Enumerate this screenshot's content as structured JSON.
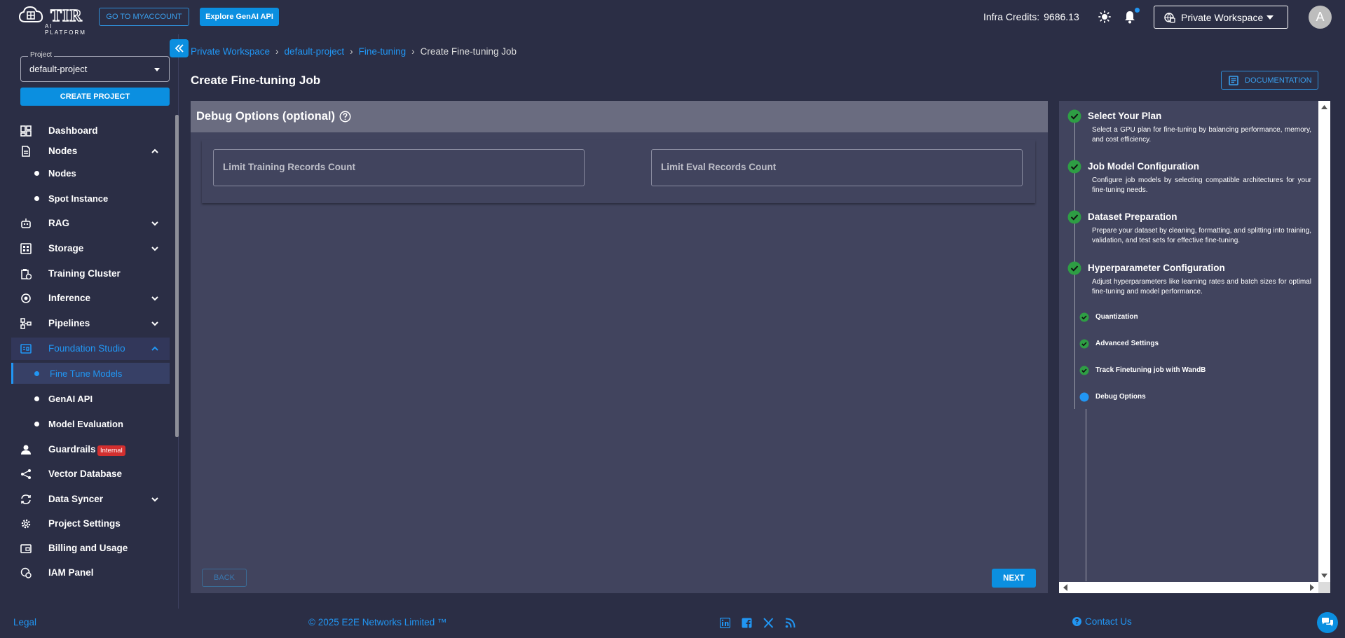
{
  "header": {
    "logo_text": "TIR",
    "logo_sub": "AI PLATFORM",
    "myaccount_label": "GO TO MYACCOUNT",
    "genai_label": "Explore GenAI API",
    "credits_label": "Infra Credits:",
    "credits_value": "9686.13",
    "workspace_label": "Private Workspace",
    "avatar_letter": "A"
  },
  "sidebar": {
    "project_legend": "Project",
    "project_value": "default-project",
    "create_project_label": "CREATE PROJECT",
    "items": [
      {
        "label": "Dashboard"
      },
      {
        "label": "Nodes"
      },
      {
        "label": "Nodes"
      },
      {
        "label": "Spot Instance"
      },
      {
        "label": "RAG"
      },
      {
        "label": "Storage"
      },
      {
        "label": "Training Cluster"
      },
      {
        "label": "Inference"
      },
      {
        "label": "Pipelines"
      },
      {
        "label": "Foundation Studio"
      },
      {
        "label": "Fine Tune Models"
      },
      {
        "label": "GenAI API"
      },
      {
        "label": "Model Evaluation"
      },
      {
        "label": "Guardrails",
        "badge": "Internal"
      },
      {
        "label": "Vector Database"
      },
      {
        "label": "Data Syncer"
      },
      {
        "label": "Project Settings"
      },
      {
        "label": "Billing and Usage"
      },
      {
        "label": "IAM Panel"
      }
    ]
  },
  "breadcrumb": {
    "items": [
      "Private Workspace",
      "default-project",
      "Fine-tuning"
    ],
    "current": "Create Fine-tuning Job"
  },
  "main": {
    "title": "Create Fine-tuning Job",
    "documentation_label": "DOCUMENTATION",
    "section_title": "Debug Options (optional)",
    "field_training_placeholder": "Limit Training Records Count",
    "field_eval_placeholder": "Limit Eval Records Count",
    "back_label": "BACK",
    "next_label": "NEXT"
  },
  "steps": {
    "items": [
      {
        "title": "Select Your Plan",
        "desc": "Select a GPU plan for fine-tuning by balancing performance, memory, and cost efficiency."
      },
      {
        "title": "Job Model Configuration",
        "desc": "Configure job models by selecting compatible architectures for your fine-tuning needs."
      },
      {
        "title": "Dataset Preparation",
        "desc": "Prepare your dataset by cleaning, formatting, and splitting into training, validation, and test sets for effective fine-tuning."
      },
      {
        "title": "Hyperparameter Configuration",
        "desc": "Adjust hyperparameters like learning rates and batch sizes for optimal fine-tuning and model performance."
      }
    ],
    "substeps": [
      {
        "label": "Quantization"
      },
      {
        "label": "Advanced Settings"
      },
      {
        "label": "Track Finetuning job with WandB"
      },
      {
        "label": "Debug Options"
      }
    ]
  },
  "footer": {
    "legal": "Legal",
    "copyright": "© 2025 E2E Networks Limited ™",
    "contact": "Contact Us"
  },
  "colors": {
    "accent": "#0b8fe0",
    "link": "#2196f3",
    "success": "#2e9e44",
    "background": "#2b2e45",
    "panel": "#41445e"
  }
}
